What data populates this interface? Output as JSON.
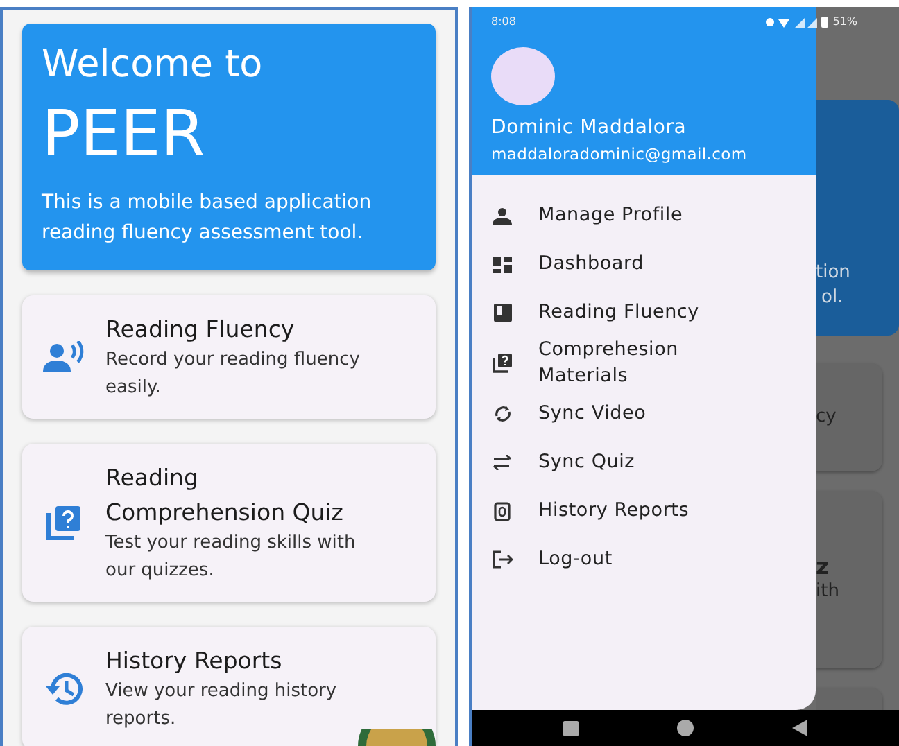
{
  "home": {
    "welcome": {
      "title": "Welcome to",
      "app_name": "PEER",
      "description": "This is a mobile based application reading fluency assessment tool."
    },
    "cards": [
      {
        "kind": "fluency",
        "title": "Reading Fluency",
        "description": "Record your reading fluency easily."
      },
      {
        "kind": "quiz",
        "title": "Reading Comprehension Quiz",
        "description": "Test your reading skills with our quizzes."
      },
      {
        "kind": "history",
        "title": "History Reports",
        "description": "View your reading history reports."
      }
    ]
  },
  "drawer_screen": {
    "status_bar": {
      "time": "8:08",
      "battery": "51%"
    },
    "user": {
      "name": "Dominic Maddalora",
      "email": "maddaloradominic@gmail.com"
    },
    "menu": [
      {
        "kind": "profile",
        "label": "Manage Profile"
      },
      {
        "kind": "dashboard",
        "label": "Dashboard"
      },
      {
        "kind": "fluency",
        "label": "Reading Fluency"
      },
      {
        "kind": "materials",
        "label": "Comprehesion Materials"
      },
      {
        "kind": "video",
        "label": "Sync Video"
      },
      {
        "kind": "quiz",
        "label": "Sync Quiz"
      },
      {
        "kind": "history",
        "label": "History Reports"
      },
      {
        "kind": "logout",
        "label": "Log-out"
      }
    ],
    "background_fragments": {
      "banner": [
        "tion",
        "ol."
      ],
      "card_1": [
        "cy"
      ],
      "card_2": [
        "z",
        "ith"
      ]
    }
  }
}
